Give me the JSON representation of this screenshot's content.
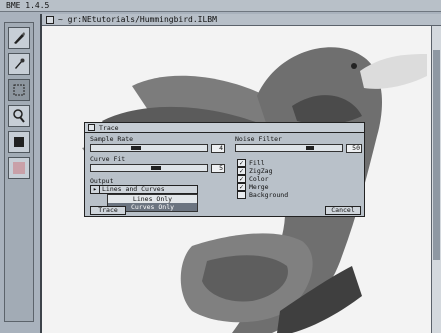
{
  "app": {
    "menubar_text": "BME 1.4.5"
  },
  "window": {
    "title": "~  gr:NEtutorials/Hummingbird.ILBM"
  },
  "toolbox": {
    "tools": [
      {
        "name": "brush-icon"
      },
      {
        "name": "eyedropper-icon"
      },
      {
        "name": "rectangle-select-icon"
      },
      {
        "name": "magnifier-icon"
      },
      {
        "name": "fill-color-icon"
      },
      {
        "name": "palette-icon"
      }
    ]
  },
  "trace_dialog": {
    "title": "Trace",
    "sample_rate": {
      "label": "Sample Rate",
      "value": "4"
    },
    "curve_fit": {
      "label": "Curve Fit",
      "value": "5"
    },
    "noise_filter": {
      "label": "Noise Filter",
      "value": "50"
    },
    "output": {
      "label": "Output",
      "current": "Lines and Curves",
      "options": [
        "Lines Only",
        "Curves Only"
      ]
    },
    "checkboxes": [
      {
        "label": "Fill",
        "checked": true
      },
      {
        "label": "ZigZag",
        "checked": true
      },
      {
        "label": "Color",
        "checked": true
      },
      {
        "label": "Merge",
        "checked": true
      },
      {
        "label": "Background",
        "checked": false
      }
    ],
    "trace_button": "Trace",
    "cancel_button": "Cancel"
  },
  "colors": {
    "bird_body": "#6f6f6f",
    "bird_wing_dark": "#4b4b4b",
    "bird_wing_mid": "#8a8a8a",
    "beak": "#dcdcdc",
    "canvas_bg": "#f3f3f3",
    "ui_gray": "#b9c1c9"
  }
}
